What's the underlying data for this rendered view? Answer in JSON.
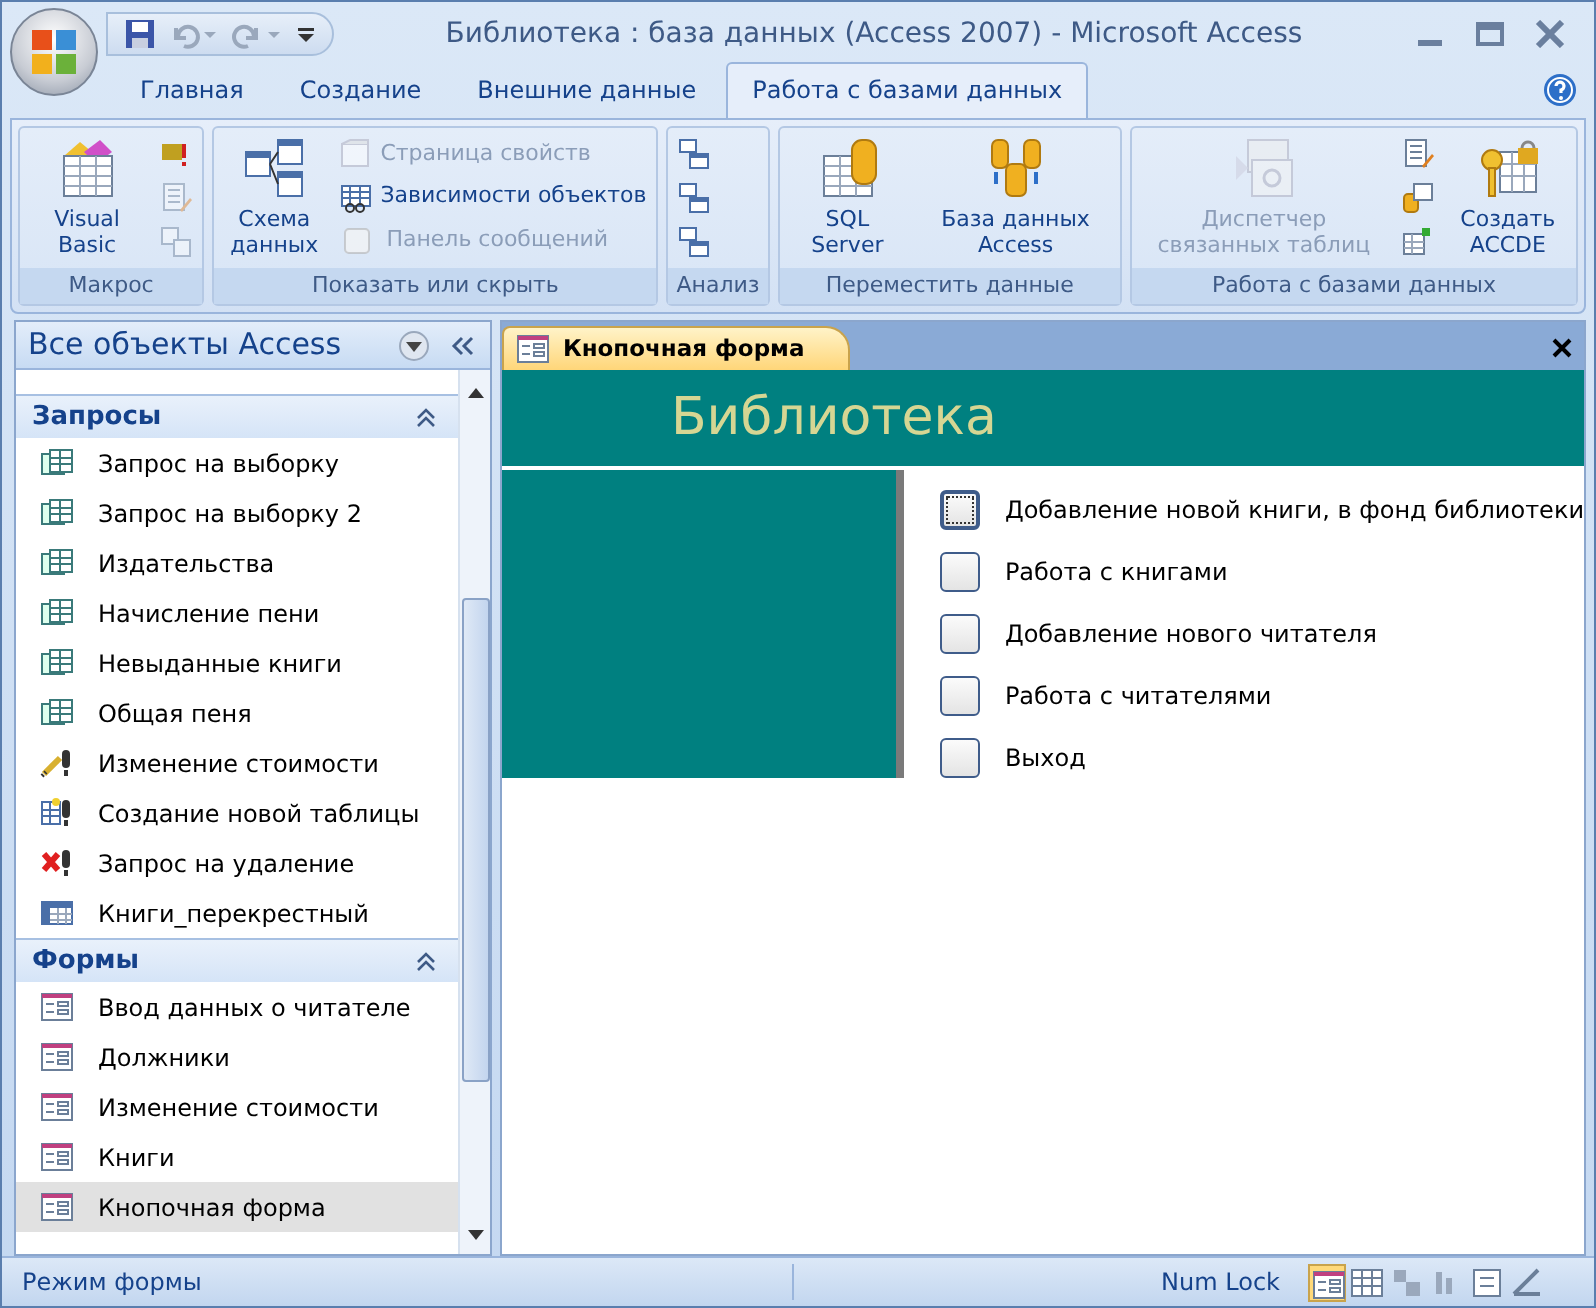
{
  "window": {
    "title": "Библиотека : база данных (Access 2007) - Microsoft Access"
  },
  "ribbon_tabs": [
    {
      "label": "Главная",
      "selected": false
    },
    {
      "label": "Создание",
      "selected": false
    },
    {
      "label": "Внешние данные",
      "selected": false
    },
    {
      "label": "Работа с базами данных",
      "selected": true
    }
  ],
  "ribbon_groups": [
    {
      "label": "Макрос",
      "controls": [
        {
          "kind": "large",
          "label": "Visual Basic",
          "disabled": false
        },
        {
          "kind": "column",
          "items": [
            {
              "disabled": false
            },
            {
              "disabled": true
            },
            {
              "disabled": true
            }
          ]
        }
      ]
    },
    {
      "label": "Показать или скрыть",
      "controls": [
        {
          "kind": "large",
          "label": "Схема данных",
          "disabled": false
        },
        {
          "kind": "list",
          "items": [
            {
              "kind": "small",
              "label": "Страница свойств",
              "disabled": true
            },
            {
              "kind": "small",
              "label": "Зависимости объектов",
              "disabled": false
            },
            {
              "kind": "check",
              "label": "Панель сообщений",
              "disabled": true,
              "checked": false
            }
          ]
        }
      ]
    },
    {
      "label": "Анализ",
      "controls": [
        {
          "kind": "column",
          "items": [
            {
              "disabled": false
            },
            {
              "disabled": false
            },
            {
              "disabled": false
            }
          ]
        }
      ]
    },
    {
      "label": "Переместить данные",
      "controls": [
        {
          "kind": "large",
          "label": "SQL Server",
          "disabled": false
        },
        {
          "kind": "large",
          "label": "База данных Access",
          "disabled": false
        }
      ]
    },
    {
      "label": "Работа с базами данных",
      "controls": [
        {
          "kind": "large",
          "label": "Диспетчер связанных таблиц",
          "disabled": true
        },
        {
          "kind": "column",
          "items": [
            {
              "disabled": false
            },
            {
              "disabled": false
            },
            {
              "disabled": false
            }
          ]
        },
        {
          "kind": "large",
          "label": "Создать ACCDE",
          "disabled": false
        }
      ]
    }
  ],
  "nav_pane": {
    "title": "Все объекты Access",
    "groups": [
      {
        "label": "Запросы",
        "items": [
          {
            "kind": "select",
            "label": "Запрос на выборку",
            "selected": false
          },
          {
            "kind": "select",
            "label": "Запрос на выборку 2",
            "selected": false
          },
          {
            "kind": "select",
            "label": "Издательства",
            "selected": false
          },
          {
            "kind": "select",
            "label": "Начисление пени",
            "selected": false
          },
          {
            "kind": "select",
            "label": "Невыданные книги",
            "selected": false
          },
          {
            "kind": "select",
            "label": "Общая пеня",
            "selected": false
          },
          {
            "kind": "update",
            "label": "Изменение стоимости",
            "selected": false
          },
          {
            "kind": "maketable",
            "label": "Создание новой таблицы",
            "selected": false
          },
          {
            "kind": "delete",
            "label": "Запрос на удаление",
            "selected": false
          },
          {
            "kind": "crosstab",
            "label": "Книги_перекрестный",
            "selected": false
          }
        ]
      },
      {
        "label": "Формы",
        "items": [
          {
            "kind": "form",
            "label": "Ввод данных о читателе",
            "selected": false
          },
          {
            "kind": "form",
            "label": "Должники",
            "selected": false
          },
          {
            "kind": "form",
            "label": "Изменение стоимости",
            "selected": false
          },
          {
            "kind": "form",
            "label": "Книги",
            "selected": false
          },
          {
            "kind": "form",
            "label": "Кнопочная форма",
            "selected": true
          }
        ]
      }
    ]
  },
  "document": {
    "tab": "Кнопочная форма",
    "header": "Библиотека",
    "buttons": [
      {
        "label": "Добавление новой книги, в фонд библиотеки",
        "focused": true
      },
      {
        "label": "Работа с книгами",
        "focused": false
      },
      {
        "label": "Добавление нового читателя",
        "focused": false
      },
      {
        "label": "Работа с читателями",
        "focused": false
      },
      {
        "label": "Выход",
        "focused": false
      }
    ]
  },
  "status_bar": {
    "mode": "Режим формы",
    "indicator": "Num Lock",
    "views": [
      {
        "selected": true
      },
      {
        "selected": false
      },
      {
        "selected": false
      },
      {
        "selected": false
      },
      {
        "selected": false
      },
      {
        "selected": false
      }
    ]
  }
}
